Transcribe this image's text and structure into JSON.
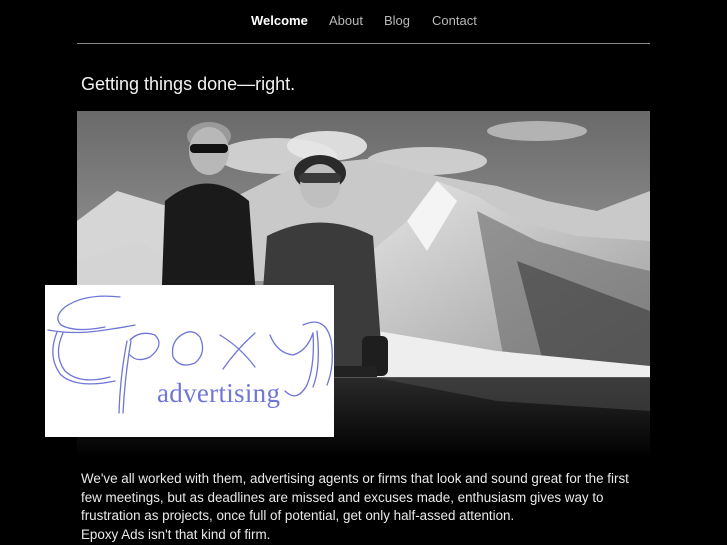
{
  "nav": {
    "items": [
      {
        "label": "Welcome",
        "active": true
      },
      {
        "label": "About",
        "active": false
      },
      {
        "label": "Blog",
        "active": false
      },
      {
        "label": "Contact",
        "active": false
      }
    ]
  },
  "tagline": "Getting things done—right.",
  "logo": {
    "script_text": "Epoxy",
    "sub_text": "advertising",
    "color": "#6f76d6"
  },
  "intro": {
    "lines": [
      "We've all worked with them, advertising agents or firms that look and sound great for the first",
      "few meetings, but as deadlines are missed and excuses made, enthusiasm gives way to",
      "frustration as projects, once full of potential, get only half-assed attention.",
      "Epoxy Ads isn't that kind of firm."
    ]
  },
  "colors": {
    "background": "#000000",
    "nav_active": "#ffffff",
    "nav_inactive": "#b8b8b8",
    "rule": "#8a8a8a"
  }
}
